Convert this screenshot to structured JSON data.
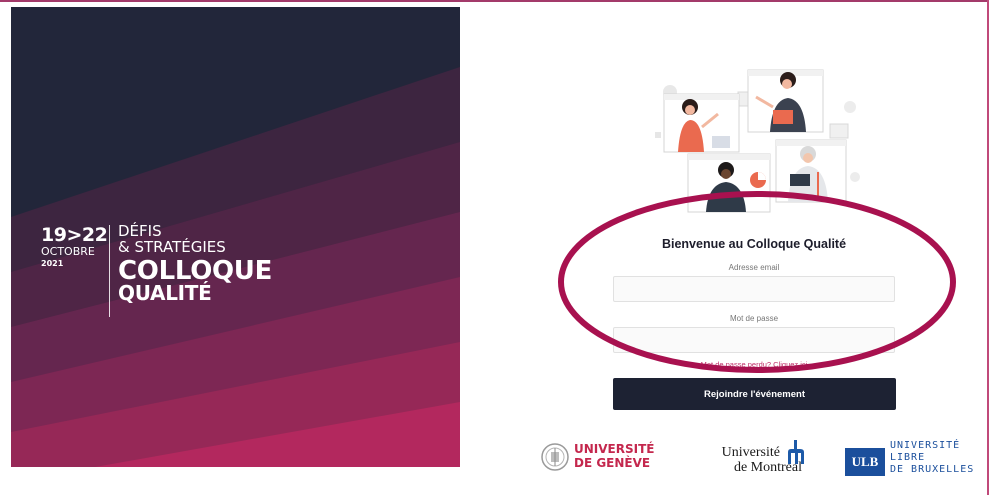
{
  "event": {
    "date_days": "19>22",
    "date_month": "OCTOBRE",
    "date_year": "2021",
    "subtitle_line1": "DÉFIS",
    "subtitle_line2": "& STRATÉGIES",
    "title_line1": "COLLOQUE",
    "title_line2": "QUALITÉ"
  },
  "login": {
    "welcome": "Bienvenue au Colloque Qualité",
    "email_label": "Adresse email",
    "email_value": "",
    "password_label": "Mot de passe",
    "password_value": "",
    "forgot_link": "Mot de passe perdu? Cliquez ici",
    "submit_label": "Rejoindre l'événement"
  },
  "partners": {
    "geneve_line1": "UNIVERSITÉ",
    "geneve_line2": "DE GENÈVE",
    "montreal_line1": "Université",
    "montreal_line2": "de Montréal",
    "ulb_abbr": "ULB",
    "ulb_line1": "UNIVERSITÉ",
    "ulb_line2": "LIBRE",
    "ulb_line3": "DE BRUXELLES"
  },
  "colors": {
    "panel_dark": "#22263a",
    "panel_pink": "#b3285e",
    "accent": "#c0306a",
    "button": "#1d2233",
    "highlight": "#a8114f"
  },
  "icons": [
    "geneve-seal-icon",
    "montreal-mark-icon",
    "ulb-logo-icon",
    "illustration"
  ]
}
